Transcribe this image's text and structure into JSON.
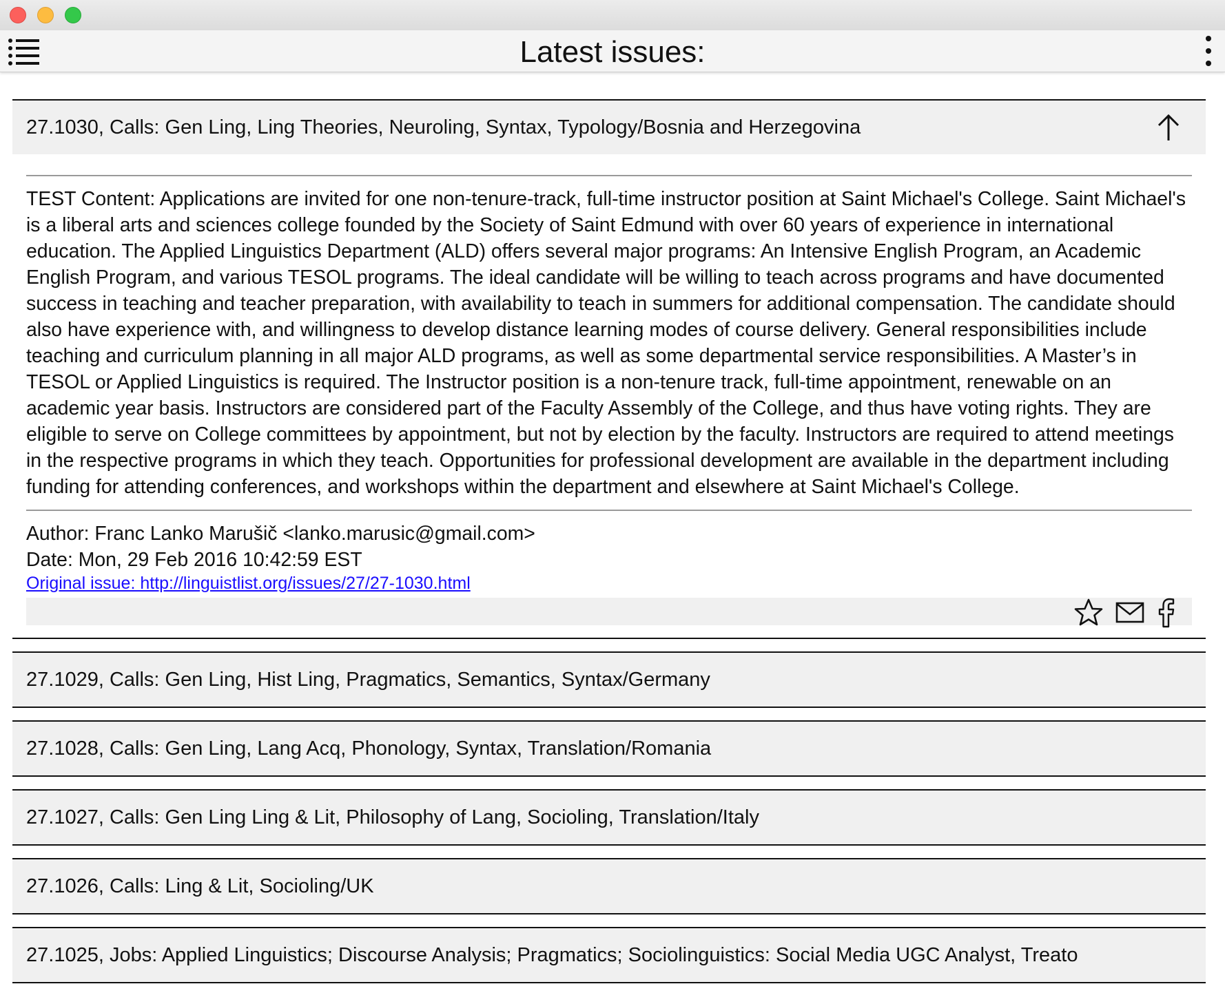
{
  "header": {
    "title": "Latest issues:",
    "menu_icon": "list-menu-icon",
    "more_icon": "more-vertical-icon"
  },
  "expanded_issue": {
    "title": "27.1030, Calls: Gen Ling, Ling Theories, Neuroling, Syntax, Typology/Bosnia and Herzegovina",
    "content": "TEST Content: Applications are invited for one non-tenure-track, full-time instructor position at Saint Michael's College. Saint Michael's is a liberal arts and sciences college founded by the Society of Saint Edmund with over 60 years of experience in international education. The Applied Linguistics Department (ALD) offers several major programs: An Intensive English Program, an Academic English Program, and various TESOL programs. The ideal candidate will be willing to teach across programs and have documented success in teaching and teacher preparation, with availability to teach in summers for additional compensation. The candidate should also have experience with, and willingness to develop distance learning modes of course delivery. General responsibilities include teaching and curriculum planning in all major ALD programs, as well as some departmental service responsibilities. A Master’s in TESOL or Applied Linguistics is required. The Instructor position is a non-tenure track, full-time appointment, renewable on an academic year basis. Instructors are considered part of the Faculty Assembly of the College, and thus have voting rights. They are eligible to serve on College committees by appointment, but not by election by the faculty. Instructors are required to attend meetings in the respective programs in which they teach. Opportunities for professional development are available in the department including funding for attending conferences, and workshops within the department and elsewhere at Saint Michael's College.",
    "author": "Author: Franc Lanko Marušič <lanko.marusic@gmail.com>",
    "date": "Date: Mon, 29 Feb 2016 10:42:59 EST",
    "link_text": "Original issue: http://linguistlist.org/issues/27/27-1030.html"
  },
  "issues": [
    {
      "title": "27.1029, Calls: Gen Ling, Hist Ling, Pragmatics, Semantics, Syntax/Germany"
    },
    {
      "title": "27.1028, Calls: Gen Ling, Lang Acq, Phonology, Syntax, Translation/Romania"
    },
    {
      "title": "27.1027, Calls: Gen Ling Ling & Lit, Philosophy of Lang, Socioling, Translation/Italy"
    },
    {
      "title": "27.1026, Calls: Ling & Lit, Socioling/UK"
    },
    {
      "title": "27.1025, Jobs: Applied Linguistics; Discourse Analysis; Pragmatics; Sociolinguistics: Social Media UGC Analyst, Treato"
    }
  ]
}
